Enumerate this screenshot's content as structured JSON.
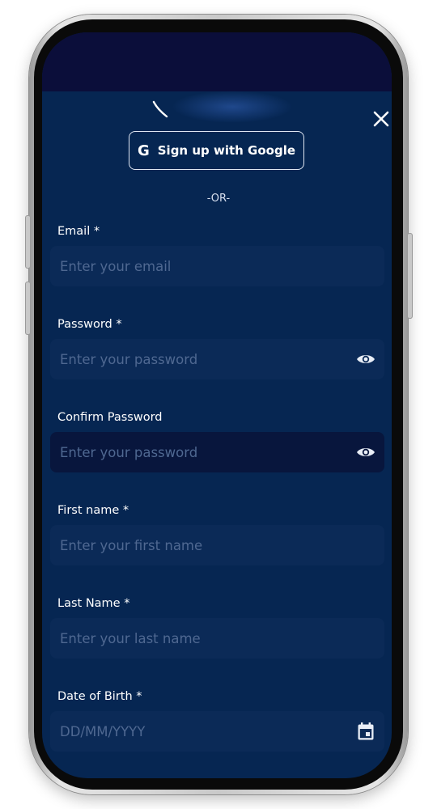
{
  "google_button": {
    "label": "Sign up with Google",
    "icon": "google-icon"
  },
  "divider": {
    "text": "-OR-"
  },
  "fields": {
    "email": {
      "label": "Email *",
      "placeholder": "Enter your email"
    },
    "password": {
      "label": "Password *",
      "placeholder": "Enter your password",
      "icon": "eye-icon"
    },
    "confirm_password": {
      "label": "Confirm Password",
      "placeholder": "Enter your password",
      "icon": "eye-icon"
    },
    "first_name": {
      "label": "First name *",
      "placeholder": "Enter your first name"
    },
    "last_name": {
      "label": "Last Name *",
      "placeholder": "Enter your last name"
    },
    "dob": {
      "label": "Date of Birth *",
      "placeholder": "DD/MM/YYYY",
      "icon": "calendar-icon"
    }
  },
  "colors": {
    "background": "#062652",
    "top_bar": "#0b0e3a",
    "field": "#0b2a57",
    "field_focused": "#08163d",
    "placeholder": "#4f6891",
    "text": "#ffffff"
  }
}
